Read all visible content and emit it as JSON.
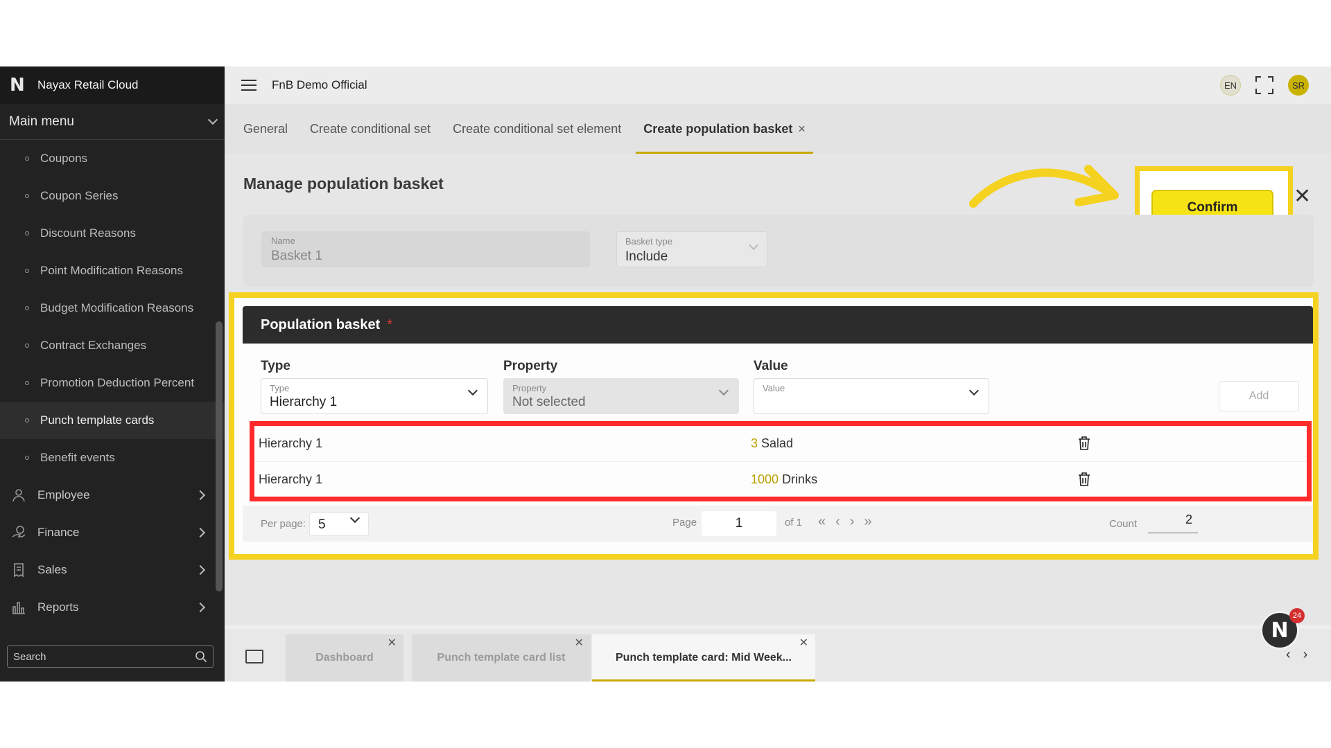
{
  "sidebar": {
    "brand": "Nayax Retail Cloud",
    "main_menu_label": "Main menu",
    "sub_items": [
      {
        "label": "Coupons"
      },
      {
        "label": "Coupon Series"
      },
      {
        "label": "Discount Reasons"
      },
      {
        "label": "Point Modification Reasons"
      },
      {
        "label": "Budget Modification Reasons"
      },
      {
        "label": "Contract Exchanges"
      },
      {
        "label": "Promotion Deduction Percent"
      },
      {
        "label": "Punch template cards",
        "active": true
      },
      {
        "label": "Benefit events"
      }
    ],
    "groups": [
      {
        "label": "Employee",
        "icon": "user-icon"
      },
      {
        "label": "Finance",
        "icon": "finance-icon"
      },
      {
        "label": "Sales",
        "icon": "receipt-icon"
      },
      {
        "label": "Reports",
        "icon": "bar-chart-icon"
      }
    ],
    "search_placeholder": "Search"
  },
  "topbar": {
    "org_name": "FnB Demo Official",
    "language": "EN",
    "user_initials": "SR"
  },
  "tabs": [
    {
      "label": "General"
    },
    {
      "label": "Create conditional set"
    },
    {
      "label": "Create conditional set element"
    },
    {
      "label": "Create population basket",
      "active": true
    }
  ],
  "page": {
    "title": "Manage population basket",
    "confirm_label": "Confirm"
  },
  "form": {
    "name_label": "Name",
    "name_value": "Basket 1",
    "basket_type_label": "Basket type",
    "basket_type_value": "Include"
  },
  "population_basket": {
    "title": "Population basket",
    "required_mark": "*",
    "columns": {
      "type": "Type",
      "property": "Property",
      "value": "Value"
    },
    "type_select": {
      "label": "Type",
      "value": "Hierarchy 1"
    },
    "property_select": {
      "label": "Property",
      "value": "Not selected"
    },
    "value_select": {
      "label": "Value",
      "value": ""
    },
    "add_label": "Add",
    "rows": [
      {
        "type": "Hierarchy 1",
        "value_code": "3",
        "value_name": "Salad"
      },
      {
        "type": "Hierarchy 1",
        "value_code": "1000",
        "value_name": "Drinks"
      }
    ],
    "pager": {
      "per_page_label": "Per page:",
      "per_page_value": "5",
      "page_label": "Page",
      "page_value": "1",
      "of_label": "of 1",
      "count_label": "Count",
      "count_value": "2"
    }
  },
  "bottom_tabs": [
    {
      "label": "Dashboard"
    },
    {
      "label": "Punch template card list"
    },
    {
      "label": "Punch template card: Mid Week...",
      "active": true
    }
  ],
  "notification_count": "24",
  "colors": {
    "accent_yellow": "#f5d21f",
    "highlight_red": "#ff2b2b",
    "sidebar_bg": "#222222"
  }
}
